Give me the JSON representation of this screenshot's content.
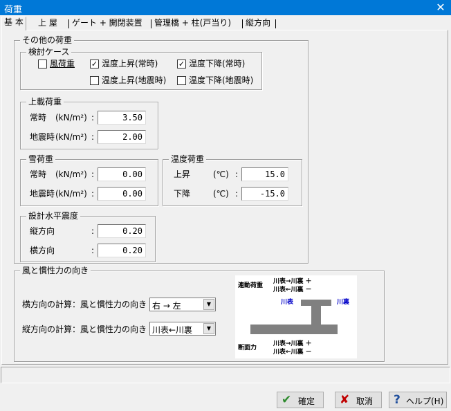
{
  "window": {
    "title": "荷重",
    "close_icon": "close-icon"
  },
  "tabs": [
    "基 本",
    "上 屋",
    "ゲート + 開閉装置",
    "管理橋 + 柱(戸当り)",
    "縦方向"
  ],
  "other_loads": {
    "legend": "その他の荷重",
    "cases": {
      "legend": "検討ケース",
      "items": [
        {
          "label": "風荷重",
          "checked": false
        },
        {
          "label": "温度上昇(常時)",
          "checked": true
        },
        {
          "label": "温度下降(常時)",
          "checked": true
        },
        {
          "label": "温度上昇(地震時)",
          "checked": false
        },
        {
          "label": "温度下降(地震時)",
          "checked": false
        }
      ]
    },
    "surcharge": {
      "legend": "上載荷重",
      "normal_label": "常時",
      "seismic_label": "地震時",
      "unit_label": "(kN/m²)",
      "normal_value": "3.50",
      "seismic_value": "2.00"
    },
    "snow": {
      "legend": "雪荷重",
      "normal_label": "常時",
      "seismic_label": "地震時",
      "unit_label": "(kN/m²)",
      "normal_value": "0.00",
      "seismic_value": "0.00"
    },
    "temperature": {
      "legend": "温度荷重",
      "rise_label": "上昇",
      "fall_label": "下降",
      "unit_label": "(℃)",
      "rise_value": "15.0",
      "fall_value": "-15.0"
    },
    "seismic_coef": {
      "legend": "設計水平震度",
      "long_label": "縦方向",
      "trans_label": "横方向",
      "long_value": "0.20",
      "trans_value": "0.20"
    }
  },
  "wind": {
    "legend": "風と慣性力の向き",
    "trans_label": "横方向の計算：風と慣性力の向き",
    "trans_value": "右 → 左",
    "long_label": "縦方向の計算：風と慣性力の向き",
    "long_value": "川表←川裏",
    "diagram": {
      "concurrent_load": "連動荷重",
      "line1": "川表→川裏 ＋",
      "line2": "川表←川裏 －",
      "river_front": "川表",
      "river_back": "川裏",
      "section_force": "断面力",
      "line3": "川表→川裏 ＋",
      "line4": "川表←川裏 －"
    }
  },
  "buttons": {
    "ok": "確定",
    "cancel": "取消",
    "help": "ヘルプ(H)"
  },
  "colors": {
    "title_bar": "#0078d7",
    "diagram_blue": "#0000c8",
    "check_green": "#2e8b2e",
    "cancel_red": "#c00000",
    "help_blue": "#1f4e9c"
  }
}
